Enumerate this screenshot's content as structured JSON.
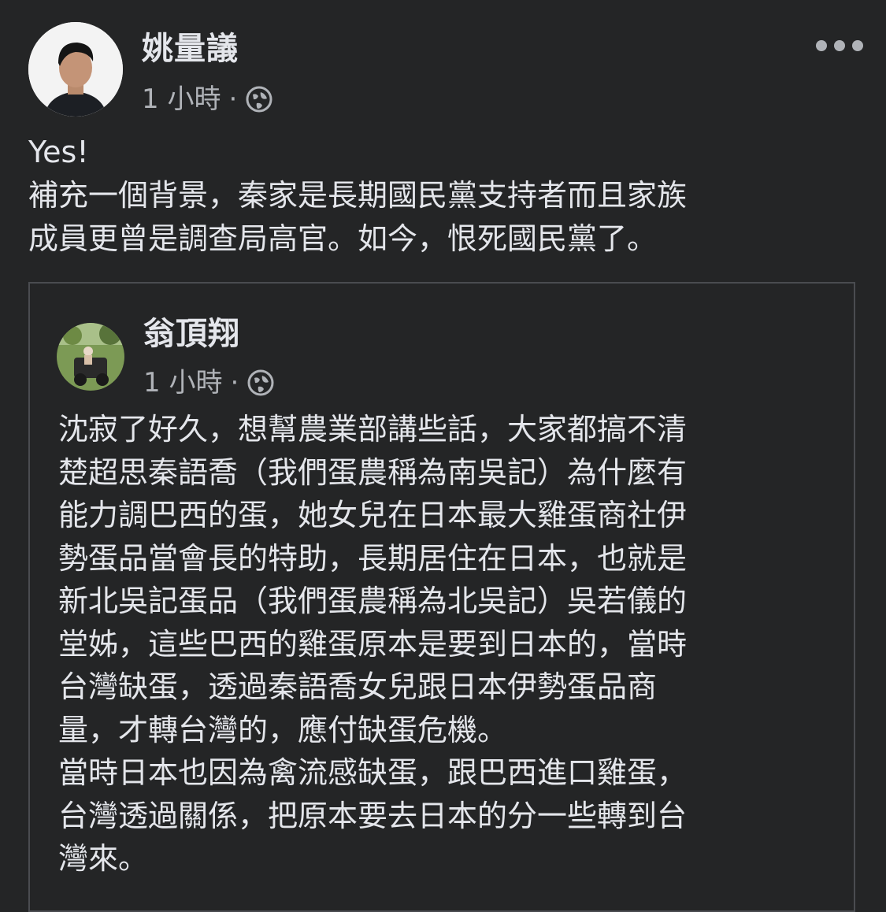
{
  "post": {
    "author": "姚量議",
    "time": "1 小時",
    "dot": "·",
    "privacy_icon": "globe-icon",
    "more_icon": "more-options-icon",
    "lines": [
      "Yes!",
      "補充一個背景，秦家是長期國民黨支持者而且家族",
      "成員更曾是調查局高官。如今，恨死國民黨了。"
    ]
  },
  "shared": {
    "author": "翁頂翔",
    "time": "1 小時",
    "dot": "·",
    "privacy_icon": "globe-icon",
    "lines": [
      "沈寂了好久，想幫農業部講些話，大家都搞不清",
      "楚超思秦語喬（我們蛋農稱為南吳記）為什麼有",
      "能力調巴西的蛋，她女兒在日本最大雞蛋商社伊",
      "勢蛋品當會長的特助，長期居住在日本，也就是",
      "新北吳記蛋品（我們蛋農稱為北吳記）吳若儀的",
      "堂姊，這些巴西的雞蛋原本是要到日本的，當時",
      "台灣缺蛋，透過秦語喬女兒跟日本伊勢蛋品商",
      "量，才轉台灣的，應付缺蛋危機。",
      "當時日本也因為禽流感缺蛋，跟巴西進口雞蛋，",
      "台灣透過關係，把原本要去日本的分一些轉到台",
      "灣來。"
    ]
  },
  "colors": {
    "background": "#242526",
    "primary_text": "#e4e6eb",
    "secondary_text": "#b0b3b8",
    "card_border": "#4a4c50"
  }
}
